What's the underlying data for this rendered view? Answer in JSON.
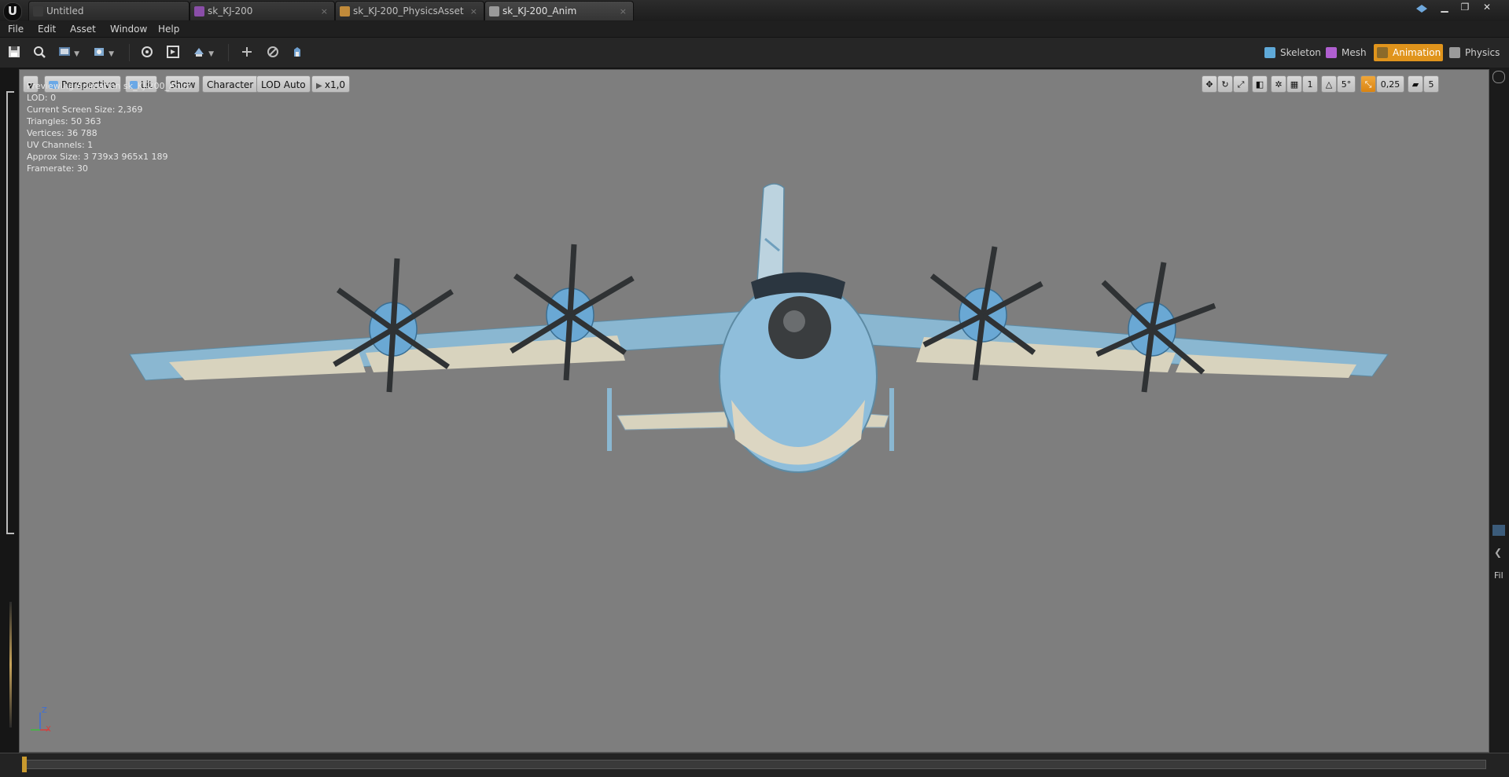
{
  "titlebar": {
    "logo": "U",
    "tabs": [
      {
        "label": "Untitled",
        "icon_color": "#3a3a3a"
      },
      {
        "label": "sk_KJ-200",
        "icon_color": "#8a4ea8"
      },
      {
        "label": "sk_KJ-200_PhysicsAsset",
        "icon_color": "#c08a3a"
      },
      {
        "label": "sk_KJ-200_Anim",
        "icon_color": "#9a9a9a"
      }
    ],
    "close_glyph": "×",
    "window_buttons": [
      "▁",
      "❐",
      "✕"
    ]
  },
  "menubar": {
    "items": [
      "File",
      "Edit",
      "Asset",
      "Window",
      "Help"
    ]
  },
  "toolbar": {
    "icons": [
      "save-icon",
      "browse-icon",
      "reimport-icon",
      "skeleton-tools-icon",
      "preview-mesh-icon",
      "animation-tools-icon",
      "make-static-mesh-icon",
      "add-icon",
      "disable-icon",
      "settings-icon"
    ],
    "modes": [
      {
        "label": "Skeleton",
        "icon_color": "#5fa9d8"
      },
      {
        "label": "Mesh",
        "icon_color": "#b05fd0"
      },
      {
        "label": "Animation",
        "icon_color": "#8b6a2a"
      },
      {
        "label": "Physics",
        "icon_color": "#9a9a9a"
      }
    ],
    "active_mode": "Animation"
  },
  "viewport": {
    "buttons": {
      "perspective": "Perspective",
      "lit": "Lit",
      "show": "Show",
      "character": "Character",
      "lod": "LOD Auto",
      "speed": "x1,0"
    },
    "right_controls": {
      "grid_value": "1",
      "rotation_value": "5°",
      "scale_value": "0,25",
      "camera_speed": "5"
    },
    "stats": [
      "Previewing Animation sk_KJ-200_Anim",
      "LOD: 0",
      "Current Screen Size: 2,369",
      "Triangles: 50 363",
      "Vertices: 36 788",
      "UV Channels: 1",
      "Approx Size: 3 739x3 965x1 189",
      "Framerate: 30"
    ],
    "axis": {
      "z": "Z",
      "x": "X"
    },
    "background": "#7e7e7e",
    "model_colors": {
      "body": "#5d9fc8",
      "panel": "#d8d3be",
      "prop": "#2f3234",
      "tip": "#d49a3a"
    }
  },
  "rightstrip": {
    "text": "Fil"
  }
}
